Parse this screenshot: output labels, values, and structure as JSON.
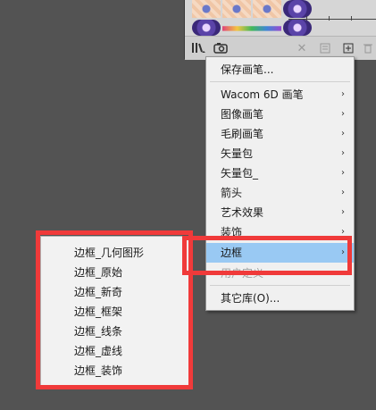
{
  "colors": {
    "background": "#535353",
    "menu_bg": "#f0f0f0",
    "highlight": "#99c9f3",
    "annotation_red": "#f03a3a"
  },
  "panel": {
    "toolbar_icons": [
      "brush-library-menu-icon",
      "libraries-icon",
      "remove-brush-stroke-icon",
      "brush-options-icon",
      "new-brush-icon",
      "delete-brush-icon"
    ]
  },
  "main_menu": {
    "items": [
      {
        "label": "保存画笔...",
        "has_submenu": false
      },
      {
        "label": "Wacom 6D 画笔",
        "has_submenu": true
      },
      {
        "label": "图像画笔",
        "has_submenu": true
      },
      {
        "label": "毛刷画笔",
        "has_submenu": true
      },
      {
        "label": "矢量包",
        "has_submenu": true
      },
      {
        "label": "矢量包_",
        "has_submenu": true
      },
      {
        "label": "箭头",
        "has_submenu": true
      },
      {
        "label": "艺术效果",
        "has_submenu": true
      },
      {
        "label": "装饰",
        "has_submenu": true
      },
      {
        "label": "边框",
        "has_submenu": true,
        "highlighted": true
      },
      {
        "label": "用户定义",
        "has_submenu": false,
        "disabled": true
      },
      {
        "label": "其它库(O)...",
        "has_submenu": false
      }
    ],
    "arrow": "›"
  },
  "sub_menu": {
    "items": [
      {
        "label": "边框_几何图形"
      },
      {
        "label": "边框_原始"
      },
      {
        "label": "边框_新奇"
      },
      {
        "label": "边框_框架"
      },
      {
        "label": "边框_线条"
      },
      {
        "label": "边框_虚线"
      },
      {
        "label": "边框_装饰"
      }
    ]
  }
}
